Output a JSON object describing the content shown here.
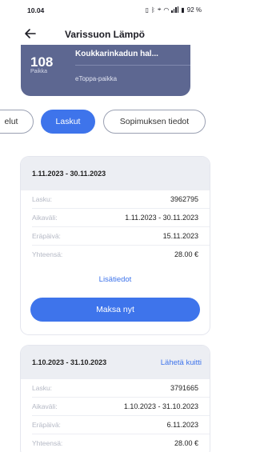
{
  "status": {
    "time": "10.04",
    "battery": "92 %"
  },
  "header": {
    "title": "Varissuon Lämpö"
  },
  "contract": {
    "number": "108",
    "number_label": "Paikka",
    "address": "Koukkarinkadun hal...",
    "type": "eToppa-paikka"
  },
  "tabs": [
    {
      "label": "elut"
    },
    {
      "label": "Laskut"
    },
    {
      "label": "Sopimuksen tiedot"
    }
  ],
  "invoices": [
    {
      "period": "1.11.2023 - 30.11.2023",
      "rows": [
        {
          "label": "Lasku:",
          "value": "3962795"
        },
        {
          "label": "Aikaväli:",
          "value": "1.11.2023 - 30.11.2023"
        },
        {
          "label": "Eräpäivä:",
          "value": "15.11.2023"
        },
        {
          "label": "Yhteensä:",
          "value": "28.00 €"
        }
      ],
      "more_label": "Lisätiedot",
      "pay_label": "Maksa nyt"
    },
    {
      "period": "1.10.2023 - 31.10.2023",
      "receipt_label": "Lähetä kuitti",
      "rows": [
        {
          "label": "Lasku:",
          "value": "3791665"
        },
        {
          "label": "Aikaväli:",
          "value": "1.10.2023 - 31.10.2023"
        },
        {
          "label": "Eräpäivä:",
          "value": "6.11.2023"
        },
        {
          "label": "Yhteensä:",
          "value": "28.00 €"
        }
      ]
    }
  ],
  "colors": {
    "accent": "#3e74eb",
    "card": "#5d6791",
    "header_bg": "#eceef3"
  },
  "icons": [
    "back-arrow-icon",
    "vibrate-icon",
    "bluetooth-icon",
    "location-icon",
    "wifi-icon",
    "signal-icon",
    "battery-icon"
  ]
}
